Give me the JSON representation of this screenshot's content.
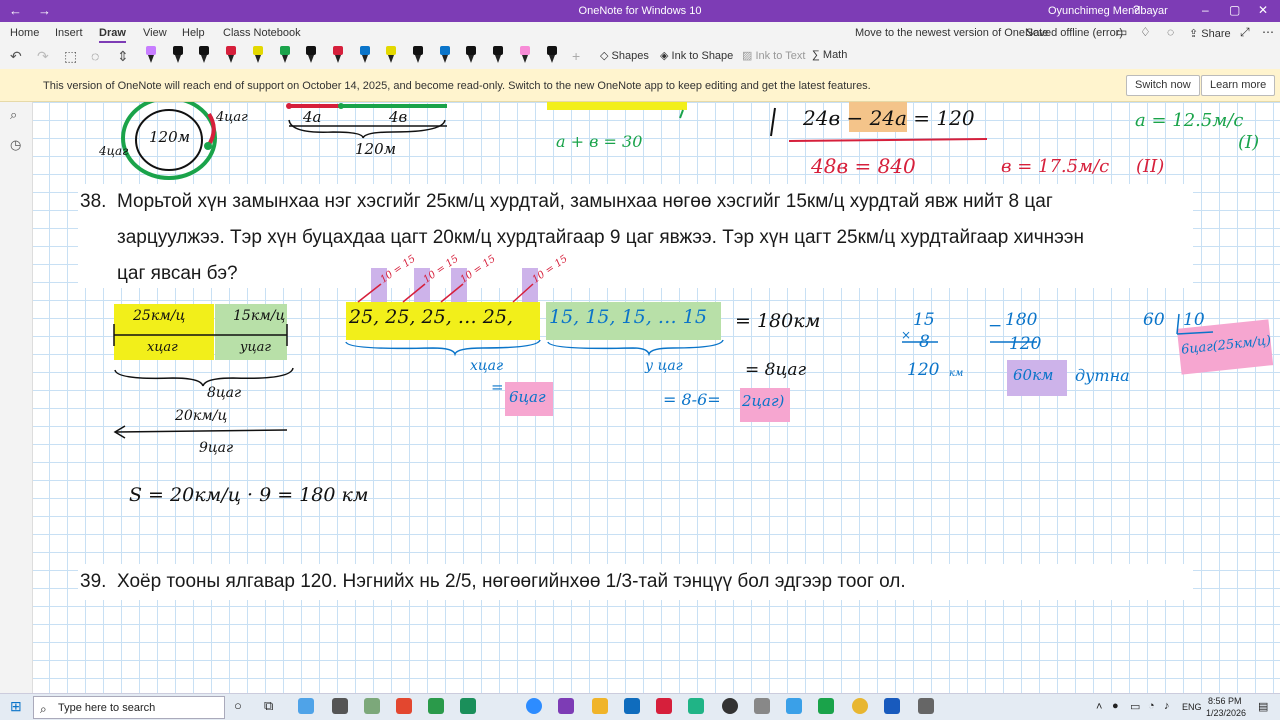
{
  "titlebar": {
    "title": "OneNote for Windows 10",
    "user": "Oyunchimeg Mendbayar",
    "back": "←",
    "forward": "→"
  },
  "menu": {
    "tabs": [
      "Home",
      "Insert",
      "Draw",
      "View",
      "Help",
      "Class Notebook"
    ],
    "active": "Draw",
    "move_link": "Move to the newest version of OneNote",
    "saved_status": "Saved offline (error)",
    "share": "Share"
  },
  "toolbar": {
    "shapes": "Shapes",
    "ink_to_shape": "Ink to Shape",
    "ink_to_text": "Ink to Text",
    "math": "Math",
    "pen_colors": [
      "#c77dff",
      "#111111",
      "#111111",
      "#d61f3b",
      "#e3d800",
      "#1aa34a",
      "#111111",
      "#d61f3b",
      "#0a74c9",
      "#e3d800",
      "#111111",
      "#0a74c9",
      "#111111",
      "#111111",
      "#f78bd6",
      "#111111"
    ]
  },
  "banner": {
    "message": "This version of OneNote will reach end of support on October 14, 2025, and become read-only. Switch to the new OneNote app to keep editing and get the latest features.",
    "switch": "Switch now",
    "learn": "Learn more"
  },
  "problems": {
    "p38_num": "38.",
    "p38_l1": "Морьтой хүн замынхаа нэг хэсгийг 25км/ц хурдтай, замынхаа нөгөө хэсгийг 15км/ц хурдтай явж нийт 8 цаг",
    "p38_l2": "зарцуулжээ. Тэр хүн буцахдаа цагт 20км/ц хурдтайгаар 9 цаг явжээ. Тэр хүн цагт 25км/ц хурдтайгаар хичнээн",
    "p38_l3": "цаг явсан бэ?",
    "p39_num": "39.",
    "p39_l1": "Хоёр тооны ялгавар 120. Нэгнийх нь 2/5, нөгөөгийнхөө 1/3-тай тэнцүү бол эдгээр тоог ол."
  },
  "ink": {
    "time_label_1": "4цаг",
    "circle_center": "120м",
    "time_label_2": "4цаг",
    "seg_a": "4а",
    "seg_b": "4в",
    "dist_total": "120м",
    "eq_sum": "a + в = 30",
    "eq_sys": "24в − 24а = 120",
    "eq_840": "48в = 840",
    "a_speed": "а = 12.5м/с",
    "mark_1": "(I)",
    "b_speed": "в = 17.5м/с",
    "mark_2": "(II)",
    "speed_25": "25км/ц",
    "speed_15": "15км/ц",
    "x_hours": "хцаг",
    "y_hours": "уцаг",
    "total_8": "8цаг",
    "back_speed": "20км/ц",
    "back_hours": "9цаг",
    "seq_25": "25, 25, 25, … 25,",
    "seq_15": "15, 15, 15, … 15",
    "eq_180": "= 180км",
    "x_label": "хцаг",
    "x_eq": "=",
    "x_value": "6цаг",
    "y_label": "у цаг",
    "eq_8": "= 8цаг",
    "y_calc": "= 8-6=",
    "y_value": "2цаг)",
    "dist_formula": "S = 20км/ц · 9 = 180 км",
    "mul_top": "15",
    "mul_x": "×",
    "mul_bot": "8",
    "mul_res": "120",
    "mul_unit": "км",
    "sub_top": "180",
    "sub_minus": "−",
    "sub_bot": "120",
    "sub_res": "60км",
    "sub_word": "дутна",
    "div_a": "60",
    "div_b": "10",
    "div_res": "6цаг(25км/ц)",
    "small_marks": [
      "10 = 15",
      "10 = 15",
      "10 = 15",
      "10 = 15"
    ]
  },
  "taskbar": {
    "search": "Type here to search",
    "time": "8:56 PM",
    "date": "1/23/2026",
    "lang": "ENG"
  }
}
